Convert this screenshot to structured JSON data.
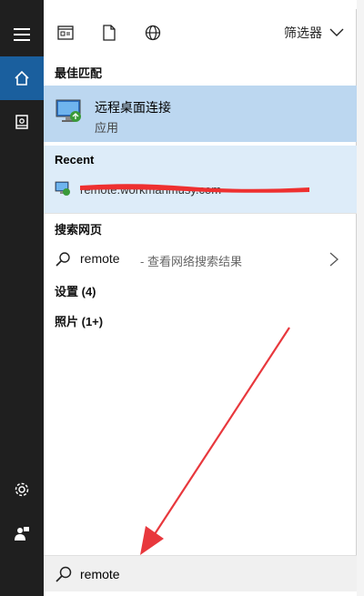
{
  "filter": {
    "label": "筛选器"
  },
  "best_match": {
    "header": "最佳匹配",
    "title": "远程桌面连接",
    "subtitle": "应用"
  },
  "recent": {
    "header": "Recent",
    "item_text": "remote.workmanmusy.com"
  },
  "web": {
    "header": "搜索网页",
    "query": "remote",
    "hint": "- 查看网络搜索结果"
  },
  "settings": {
    "label": "设置 (4)"
  },
  "photos": {
    "label": "照片 (1+)"
  },
  "search": {
    "value": "remote"
  },
  "colors": {
    "rail_bg": "#1f1f1f",
    "rail_active": "#1a5f9e",
    "best_match_bg": "#bcd7f0",
    "recent_bg": "#ddecf9",
    "search_bg": "#f0f0f0",
    "annotation_red": "#e8383d"
  },
  "icons": {
    "rail": [
      "hamburger-icon",
      "home-icon",
      "notebook-icon",
      "settings-icon",
      "feedback-icon"
    ],
    "toolbar": [
      "document-icon",
      "file-icon",
      "globe-icon",
      "chevron-down-icon"
    ]
  }
}
